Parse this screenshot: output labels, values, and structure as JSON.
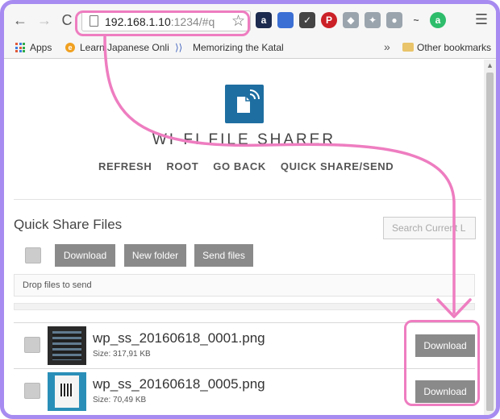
{
  "browser": {
    "url_host": "192.168.1.10",
    "url_rest": ":1234/#q",
    "bookmarks": {
      "apps": "Apps",
      "b1": "Learn Japanese Online",
      "b2": "Memorizing the Katakana",
      "more": "»",
      "other": "Other bookmarks"
    },
    "ext_icons": [
      {
        "name": "amazon-assistant-icon",
        "color": "#1b2a4e",
        "glyph": "a"
      },
      {
        "name": "chat-bubble-icon",
        "color": "#3b6fd4",
        "glyph": ""
      },
      {
        "name": "pocket-icon",
        "color": "#444444",
        "glyph": "✓"
      },
      {
        "name": "pinterest-icon",
        "color": "#cb2027",
        "glyph": "P"
      },
      {
        "name": "dropbox-icon",
        "color": "#9aa4ad",
        "glyph": "◆"
      },
      {
        "name": "puzzle-icon",
        "color": "#9aa4ad",
        "glyph": "✦"
      },
      {
        "name": "globe-icon",
        "color": "#9aa4ad",
        "glyph": "●"
      },
      {
        "name": "tilde-icon",
        "color": "#f6f6f6",
        "glyph": "~"
      },
      {
        "name": "green-circle-icon",
        "color": "#2ebd6b",
        "glyph": "a"
      }
    ]
  },
  "app": {
    "title": "WI-FI FILE SHARER",
    "nav": [
      "REFRESH",
      "ROOT",
      "GO BACK",
      "QUICK SHARE/SEND"
    ]
  },
  "section": {
    "title": "Quick Share Files",
    "search_placeholder": "Search Current L",
    "buttons": {
      "download": "Download",
      "new_folder": "New folder",
      "send_files": "Send files"
    },
    "dropzone": "Drop files to send"
  },
  "files": [
    {
      "name": "wp_ss_20160618_0001.png",
      "size": "Size: 317,91 KB",
      "action": "Download"
    },
    {
      "name": "wp_ss_20160618_0005.png",
      "size": "Size: 70,49 KB",
      "action": "Download"
    }
  ],
  "colors": {
    "annotation": "#ee7dc0",
    "frame": "#a78bf0",
    "logo": "#1e6ea1",
    "button": "#8a8a8a"
  }
}
